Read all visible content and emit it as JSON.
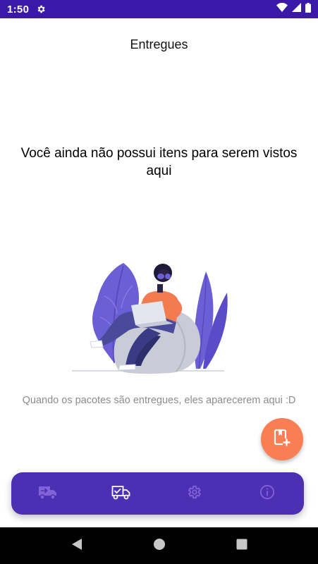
{
  "status_bar": {
    "time": "1:50",
    "icons": [
      "gear-icon",
      "wifi-icon",
      "signal-icon",
      "battery-icon"
    ]
  },
  "header": {
    "title": "Entregues"
  },
  "empty_state": {
    "heading": "Você ainda não possui itens para serem vistos aqui",
    "caption": "Quando os pacotes são entregues, eles aparecerem aqui :D",
    "illustration": "person-with-laptop-on-beanbag"
  },
  "fab": {
    "icon": "add-package-icon"
  },
  "bottom_nav": {
    "items": [
      {
        "icon": "truck-icon",
        "active": false
      },
      {
        "icon": "truck-check-icon",
        "active": true
      },
      {
        "icon": "settings-icon",
        "active": false
      },
      {
        "icon": "info-icon",
        "active": false
      }
    ]
  },
  "system_nav": {
    "buttons": [
      "back-icon",
      "home-icon",
      "recents-icon"
    ]
  },
  "colors": {
    "status_bar": "#3b19a8",
    "nav_bar": "#4d2fb4",
    "nav_icon_inactive": "#7f63d8",
    "nav_icon_active": "#ffffff",
    "fab": "#fa7e53",
    "caption": "#8c8c8c",
    "illustration_purple": "#6b5fd6",
    "illustration_orange": "#f47b4f"
  }
}
